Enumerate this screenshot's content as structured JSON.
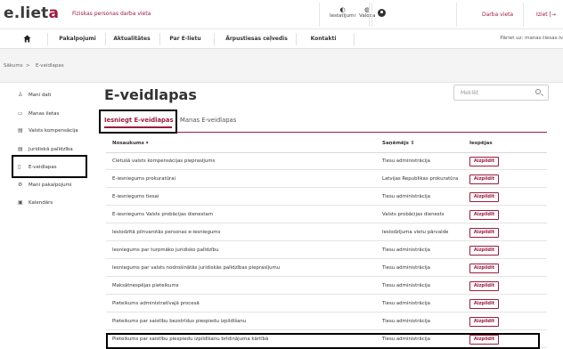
{
  "header": {
    "logo_main": "e.liet",
    "logo_accent": "a",
    "subtitle": "Fiziskas personas darba vieta",
    "settings_label": "Iestatījumi",
    "language_label": "Valoda",
    "workplace_link": "Darba vieta",
    "logout_link": "Iziet [→"
  },
  "nav": {
    "items": [
      "Pakalpojumi",
      "Aktualitātes",
      "Par E-lietu",
      "Ārpustiesas ceļvedis",
      "Kontakti"
    ],
    "switch_text": "Pāriet uz: manas.tiesas.lv"
  },
  "breadcrumb": {
    "home": "Sākums",
    "separator": ">",
    "current": "E-veidlapas"
  },
  "sidebar": {
    "items": [
      {
        "icon": "♙",
        "label": "Mani dati"
      },
      {
        "icon": "▭",
        "label": "Manas lietas"
      },
      {
        "icon": "▤",
        "label": "Valsts kompensācija"
      },
      {
        "icon": "▤",
        "label": "Juridiskā palīdzība"
      },
      {
        "icon": "▯",
        "label": "E-veidlapas"
      },
      {
        "icon": "⚙",
        "label": "Mani pakalpojumi"
      },
      {
        "icon": "▣",
        "label": "Kalendārs"
      }
    ]
  },
  "main": {
    "title": "E-veidlapas",
    "search_placeholder": "Meklēt",
    "tabs": [
      "Iesniegt E-veidlapas",
      "Manas E-veidlapas"
    ],
    "table": {
      "headers": [
        "Nosaukums ▾",
        "Saņēmējs ⇕",
        "Iespējas"
      ],
      "button_label": "Aizpildīt",
      "rows": [
        [
          "Cietušā valsts kompensācijas pieprasījums",
          "Tiesu administrācija"
        ],
        [
          "E-iesniegums prokuratūrai",
          "Latvijas Republikas prokuratūra"
        ],
        [
          "E-iesniegums tiesai",
          "Tiesu administrācija"
        ],
        [
          "E-iesniegums Valsts probācijas dienestam",
          "Valsts probācijas dienests"
        ],
        [
          "Ieslodzītā pilnvarotās personas e-iesniegums",
          "Ieslodzījuma vietu pārvalde"
        ],
        [
          "Iesniegums par turpmāko juridisko palīdzību",
          "Tiesu administrācija"
        ],
        [
          "Iesniegums par valsts nodrošinātās juridiskās palīdzības pieprasījumu",
          "Tiesu administrācija"
        ],
        [
          "Maksātnespējas pieteikums",
          "Tiesu administrācija"
        ],
        [
          "Pieteikums administratīvajā procesā",
          "Tiesu administrācija"
        ],
        [
          "Pieteikums par saistību bezstrīdus piespiedu izpildīšanu",
          "Tiesu administrācija"
        ],
        [
          "Pieteikums par saistību piespiedu izpildīšanu brīdinājuma kārtībā",
          "Tiesu administrācija"
        ]
      ]
    }
  },
  "colors": {
    "accent": "#9c1b3e",
    "text": "#333333",
    "crumb_bg": "#f4f4f4"
  }
}
